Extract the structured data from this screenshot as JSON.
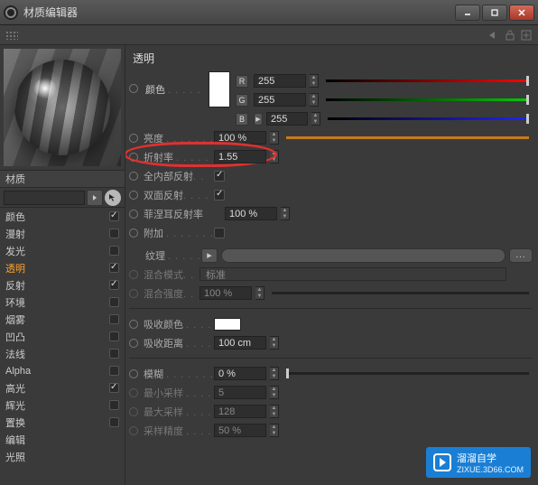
{
  "window": {
    "title": "材质编辑器"
  },
  "material": {
    "name": "材质"
  },
  "channels": [
    {
      "key": "color",
      "label": "颜色",
      "checked": true,
      "active": false
    },
    {
      "key": "diffuse",
      "label": "漫射",
      "checked": false,
      "active": false
    },
    {
      "key": "luminance",
      "label": "发光",
      "checked": false,
      "active": false
    },
    {
      "key": "transparency",
      "label": "透明",
      "checked": true,
      "active": true
    },
    {
      "key": "reflection",
      "label": "反射",
      "checked": true,
      "active": false
    },
    {
      "key": "environment",
      "label": "环境",
      "checked": false,
      "active": false
    },
    {
      "key": "fog",
      "label": "烟雾",
      "checked": false,
      "active": false
    },
    {
      "key": "bump",
      "label": "凹凸",
      "checked": false,
      "active": false
    },
    {
      "key": "normal",
      "label": "法线",
      "checked": false,
      "active": false
    },
    {
      "key": "alpha",
      "label": "Alpha",
      "checked": false,
      "active": false
    },
    {
      "key": "specular",
      "label": "高光",
      "checked": true,
      "active": false
    },
    {
      "key": "glow",
      "label": "辉光",
      "checked": false,
      "active": false
    },
    {
      "key": "displacement",
      "label": "置换",
      "checked": false,
      "active": false
    },
    {
      "key": "editor",
      "label": "编辑",
      "checked": null,
      "active": false
    },
    {
      "key": "illumination",
      "label": "光照",
      "checked": null,
      "active": false
    }
  ],
  "panel": {
    "title": "透明",
    "color_label": "颜色",
    "rgb": {
      "r_label": "R",
      "r": "255",
      "g_label": "G",
      "g": "255",
      "b_label": "B",
      "b": "255"
    },
    "brightness": {
      "label": "亮度",
      "value": "100 %"
    },
    "refraction": {
      "label": "折射率",
      "value": "1.55"
    },
    "total_internal": {
      "label": "全内部反射",
      "checked": true
    },
    "double_sided": {
      "label": "双面反射",
      "checked": true
    },
    "fresnel": {
      "label": "菲涅耳反射率",
      "value": "100 %"
    },
    "additive": {
      "label": "附加",
      "checked": false
    },
    "texture": {
      "label": "纹理"
    },
    "blend_mode": {
      "label": "混合模式",
      "value": "标准"
    },
    "blend_strength": {
      "label": "混合强度",
      "value": "100 %"
    },
    "absorb_color": {
      "label": "吸收颜色"
    },
    "absorb_distance": {
      "label": "吸收距离",
      "value": "100 cm"
    },
    "blur": {
      "label": "模糊",
      "value": "0 %"
    },
    "min_samples": {
      "label": "最小采样",
      "value": "5"
    },
    "max_samples": {
      "label": "最大采样",
      "value": "128"
    },
    "sample_accuracy": {
      "label": "采样精度",
      "value": "50 %"
    }
  },
  "watermark": {
    "text": "溜溜自学",
    "sub": "ZIXUE.3D66.COM"
  }
}
